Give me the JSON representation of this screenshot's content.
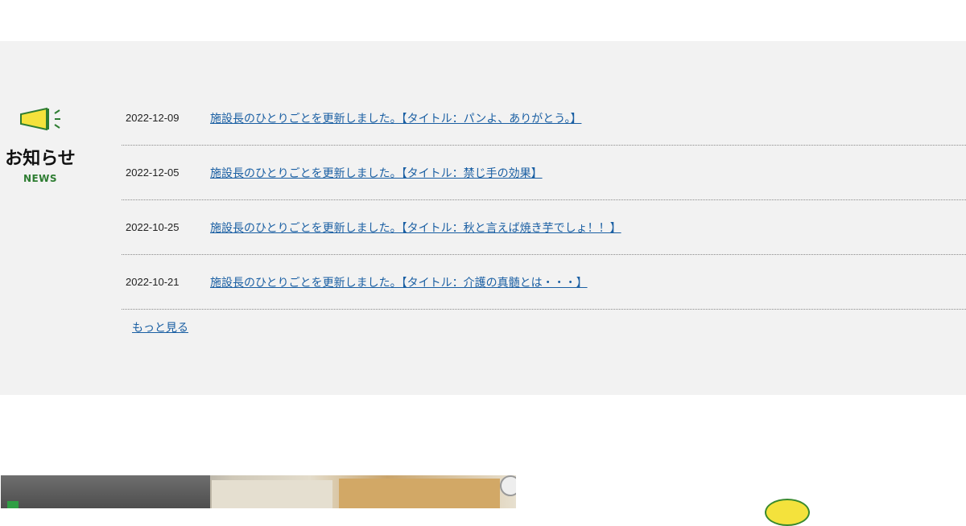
{
  "news": {
    "heading": "お知らせ",
    "heading_en": "NEWS",
    "items": [
      {
        "date": "2022-12-09",
        "title": "施設長のひとりごとを更新しました。【タイトル：パンよ、ありがとう。】"
      },
      {
        "date": "2022-12-05",
        "title": "施設長のひとりごとを更新しました。【タイトル：禁じ手の効果】"
      },
      {
        "date": "2022-10-25",
        "title": "施設長のひとりごとを更新しました。【タイトル：秋と言えば焼き芋でしょ！！】"
      },
      {
        "date": "2022-10-21",
        "title": "施設長のひとりごとを更新しました。【タイトル：介護の真髄とは・・・】"
      }
    ],
    "more_label": "もっと見る"
  },
  "colors": {
    "section_bg": "#f2f2f2",
    "link": "#1a5fa3",
    "accent_green": "#2e7d32",
    "megaphone_yellow": "#f4e23c"
  },
  "icons": {
    "heading_icon": "megaphone-icon"
  }
}
